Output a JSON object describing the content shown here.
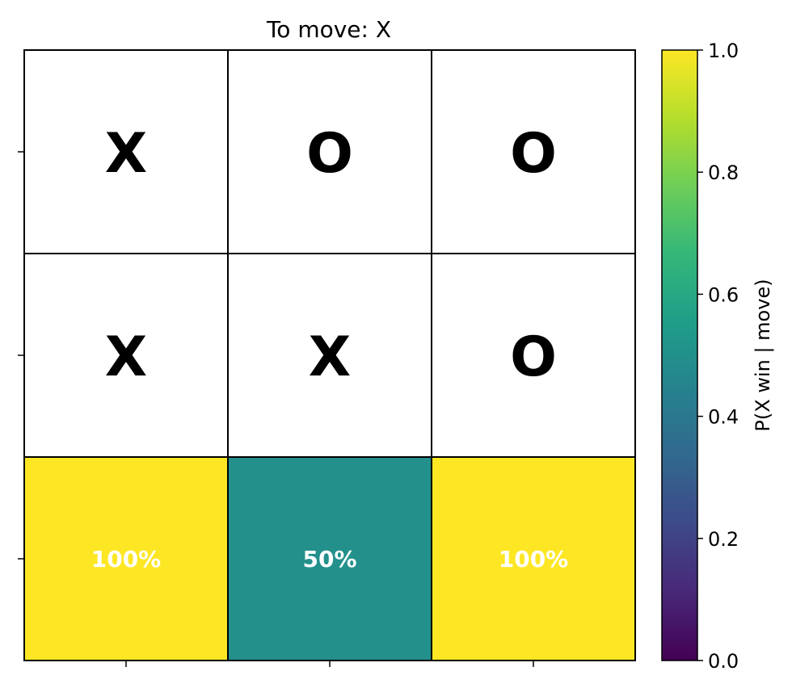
{
  "title": "To move: X",
  "board": {
    "rows": 3,
    "cols": 3,
    "cells": [
      {
        "row": 0,
        "col": 0,
        "piece": "X",
        "prob": null,
        "label": ""
      },
      {
        "row": 0,
        "col": 1,
        "piece": "O",
        "prob": null,
        "label": ""
      },
      {
        "row": 0,
        "col": 2,
        "piece": "O",
        "prob": null,
        "label": ""
      },
      {
        "row": 1,
        "col": 0,
        "piece": "X",
        "prob": null,
        "label": ""
      },
      {
        "row": 1,
        "col": 1,
        "piece": "X",
        "prob": null,
        "label": ""
      },
      {
        "row": 1,
        "col": 2,
        "piece": "O",
        "prob": null,
        "label": ""
      },
      {
        "row": 2,
        "col": 0,
        "piece": "",
        "prob": 1.0,
        "label": "100%"
      },
      {
        "row": 2,
        "col": 1,
        "piece": "",
        "prob": 0.5,
        "label": "50%"
      },
      {
        "row": 2,
        "col": 2,
        "piece": "",
        "prob": 1.0,
        "label": "100%"
      }
    ],
    "empty_color": "#ffffff",
    "grid_color": "#000000"
  },
  "colorbar": {
    "label": "P(X win | move)",
    "range": [
      0.0,
      1.0
    ],
    "ticks": [
      "0.0",
      "0.2",
      "0.4",
      "0.6",
      "0.8",
      "1.0"
    ],
    "colormap": "viridis",
    "stops": [
      "#440154",
      "#482878",
      "#3e4989",
      "#31688e",
      "#26828e",
      "#1f9e89",
      "#35b779",
      "#6ece58",
      "#b5de2b",
      "#fde725"
    ]
  }
}
